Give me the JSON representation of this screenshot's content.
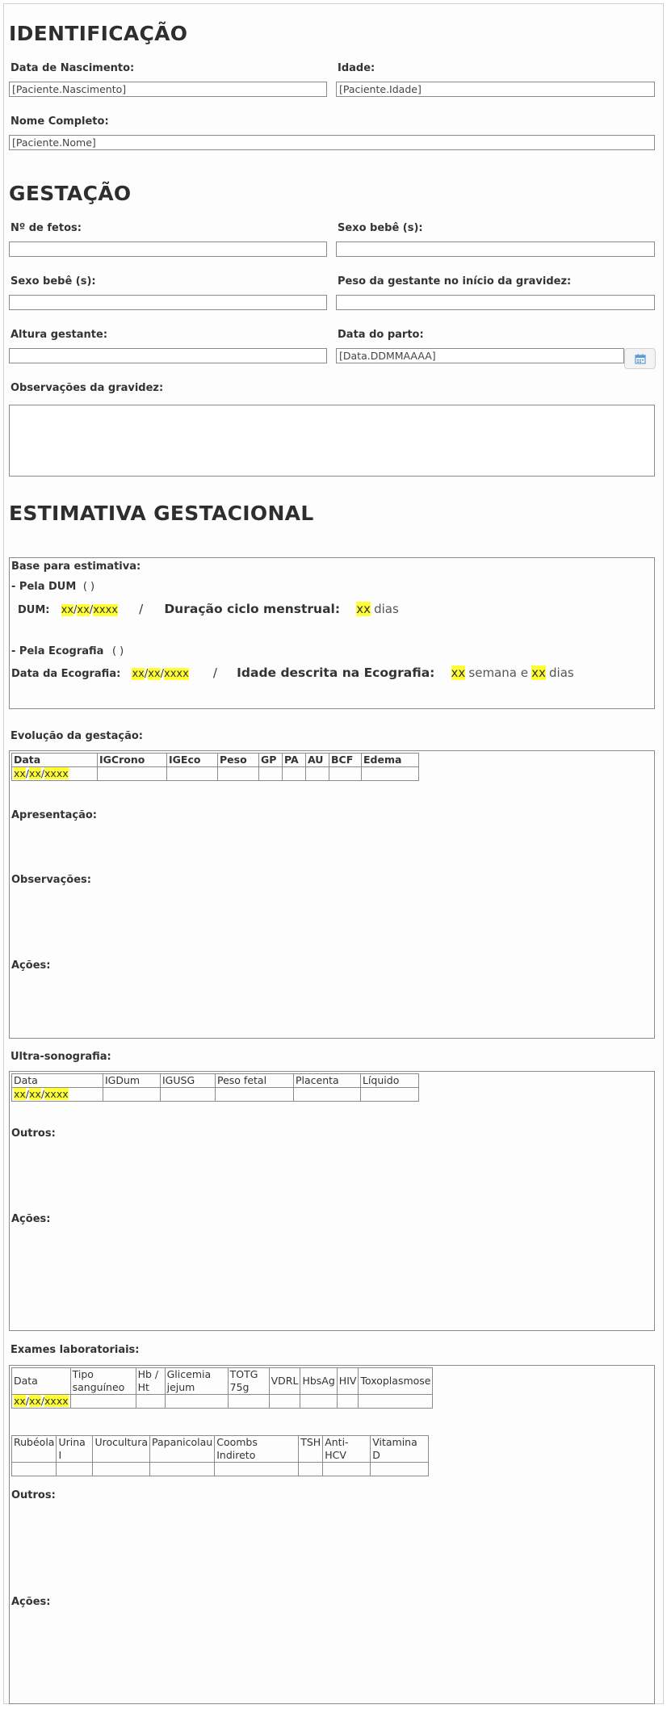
{
  "identificacao": {
    "title": "IDENTIFICAÇÃO",
    "nascimento_label": "Data de Nascimento:",
    "nascimento_value": "[Paciente.Nascimento]",
    "idade_label": "Idade:",
    "idade_value": "[Paciente.Idade]",
    "nome_label": "Nome Completo:",
    "nome_value": "[Paciente.Nome]"
  },
  "gestacao": {
    "title": "GESTAÇÃO",
    "fetos_label": "Nº de fetos:",
    "sexo1_label": "Sexo bebê (s):",
    "sexo2_label": "Sexo bebê (s):",
    "peso_label": "Peso da gestante no início da gravidez:",
    "altura_label": "Altura gestante:",
    "parto_label": "Data do parto:",
    "parto_value": "[Data.DDMMAAAA]",
    "obs_label": "Observações da gravidez:"
  },
  "estimativa": {
    "title": "ESTIMATIVA GESTACIONAL",
    "base_label": "Base para estimativa:",
    "dum_option": "- Pela DUM",
    "dum_paren": "(   )",
    "dum_label": "DUM:",
    "xx": "xx",
    "xxxx": "xxxx",
    "slash": "/",
    "sep": "/",
    "ciclo_label": "Duração ciclo menstrual:",
    "dias": "dias",
    "eco_option": "- Pela Ecografia",
    "eco_paren": "(   )",
    "eco_date_label": "Data da Ecografia:",
    "eco_idade_label": "Idade descrita na Ecografia:",
    "semana_e": "semana e"
  },
  "evolucao": {
    "label": "Evolução da gestação:",
    "headers": [
      "Data",
      "IGCrono",
      "IGEco",
      "Peso",
      "GP",
      "PA",
      "AU",
      "BCF",
      "Edema"
    ],
    "apresentacao_label": "Apresentação:",
    "observacoes_label": "Observações:",
    "acoes_label": "Ações:"
  },
  "ultra": {
    "label": "Ultra-sonografia:",
    "headers": [
      "Data",
      "IGDum",
      "IGUSG",
      "Peso fetal",
      "Placenta",
      "Líquido"
    ],
    "outros_label": "Outros:",
    "acoes_label": "Ações:"
  },
  "exames": {
    "label": "Exames laboratoriais:",
    "headers1": [
      "Data",
      "Tipo sanguíneo",
      "Hb / Ht",
      "Glicemia jejum",
      "TOTG 75g",
      "VDRL",
      "HbsAg",
      "HIV",
      "Toxoplasmose"
    ],
    "headers2": [
      "Rubéola",
      "Urina I",
      "Urocultura",
      "Papanicolau",
      "Coombs Indireto",
      "TSH",
      "Anti-HCV",
      "Vitamina D"
    ],
    "outros_label": "Outros:",
    "acoes_label": "Ações:"
  },
  "colors": {
    "highlight": "#ffff33",
    "border": "#8a8a8a",
    "calendar_icon": "#5b9bd5"
  },
  "icons": {
    "calendar": "calendar-icon"
  }
}
